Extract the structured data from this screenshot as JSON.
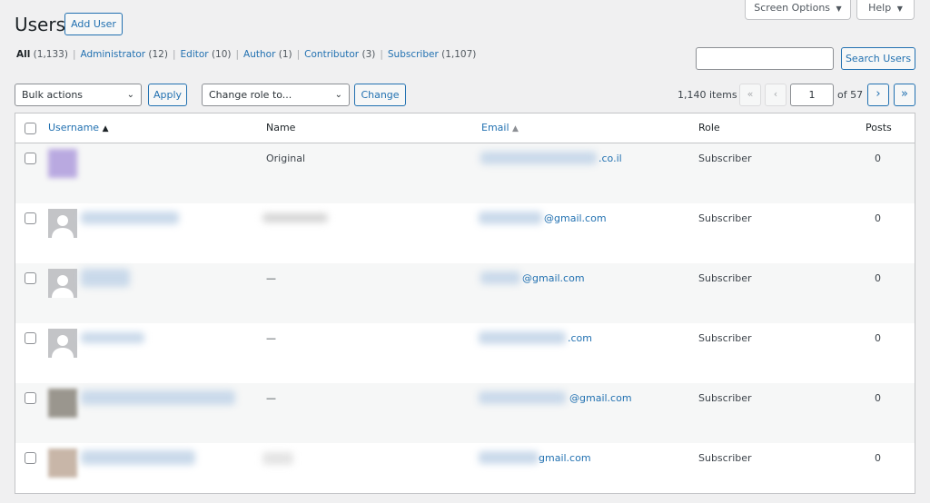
{
  "header": {
    "title": "Users",
    "add_user": "Add User",
    "screen_options": "Screen Options",
    "help": "Help",
    "caret": "▼"
  },
  "filters": [
    {
      "label": "All",
      "count": "(1,133)",
      "current": true
    },
    {
      "label": "Administrator",
      "count": "(12)"
    },
    {
      "label": "Editor",
      "count": "(10)"
    },
    {
      "label": "Author",
      "count": "(1)"
    },
    {
      "label": "Contributor",
      "count": "(3)"
    },
    {
      "label": "Subscriber",
      "count": "(1,107)"
    }
  ],
  "search": {
    "value": "",
    "button": "Search Users"
  },
  "bulk": {
    "selected": "Bulk actions",
    "apply": "Apply"
  },
  "role": {
    "selected": "Change role to...",
    "change": "Change"
  },
  "pagination": {
    "items": "1,140 items",
    "first": "«",
    "prev": "‹",
    "page": "1",
    "of": "of 57",
    "next": "›",
    "last": "»"
  },
  "table": {
    "columns": {
      "username": "Username",
      "name": "Name",
      "email": "Email",
      "role": "Role",
      "posts": "Posts"
    },
    "rows": [
      {
        "name": "Original",
        "email": ".co.il",
        "role": "Subscriber",
        "posts": "0",
        "avatar": "purple-blur"
      },
      {
        "name": "",
        "email": "@gmail.com",
        "role": "Subscriber",
        "posts": "0",
        "avatar": "default"
      },
      {
        "name": "—",
        "email": "@gmail.com",
        "role": "Subscriber",
        "posts": "0",
        "avatar": "default"
      },
      {
        "name": "—",
        "email": ".com",
        "role": "Subscriber",
        "posts": "0",
        "avatar": "default"
      },
      {
        "name": "—",
        "email": "@gmail.com",
        "role": "Subscriber",
        "posts": "0",
        "avatar": "photo"
      },
      {
        "name": "",
        "email": "gmail.com",
        "role": "Subscriber",
        "posts": "0",
        "avatar": "photo"
      }
    ]
  },
  "colors": {
    "accent": "#2271b1",
    "background": "#f0f0f1",
    "alt_row": "#f6f7f7"
  }
}
